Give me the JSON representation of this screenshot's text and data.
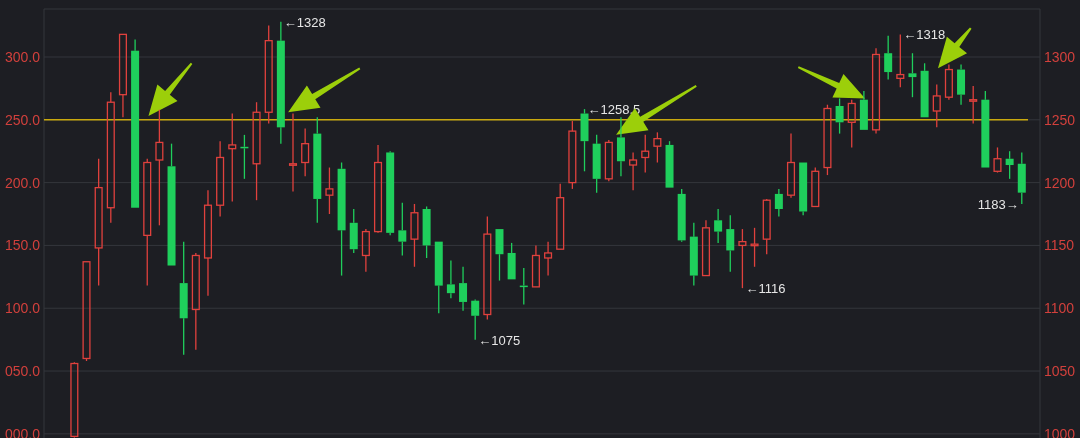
{
  "left_axis_labels": [
    "300.0",
    "250.0",
    "200.0",
    "150.0",
    "100.0",
    "050.0",
    "000.0"
  ],
  "chart_data": {
    "type": "candlestick",
    "ylim": [
      996.7,
      1338.2
    ],
    "yticks": [
      1300,
      1250,
      1200,
      1150,
      1100,
      1050,
      1000
    ],
    "grid": true,
    "categories": [
      null,
      null,
      null,
      null,
      null,
      null,
      null,
      null,
      null,
      null,
      null,
      null,
      null,
      null,
      null,
      null,
      null,
      null,
      null,
      null,
      null,
      null,
      null,
      null,
      null,
      null,
      null,
      null,
      null,
      null,
      null,
      null,
      null,
      null,
      null,
      null,
      null,
      null,
      null,
      null,
      null,
      null,
      null,
      null,
      null,
      null,
      null,
      null,
      null,
      null,
      null,
      null,
      null,
      null,
      null,
      null,
      null,
      null,
      null,
      null,
      null,
      null,
      null,
      null,
      null,
      null,
      null,
      null,
      null,
      null,
      null,
      null,
      null,
      null,
      null,
      null,
      null,
      null,
      null,
      null,
      null,
      null
    ],
    "ohlc": [
      null,
      null,
      [
        998,
        1057,
        997,
        1056
      ],
      [
        1060,
        1137,
        1058,
        1137
      ],
      [
        1148,
        1219,
        1118,
        1196
      ],
      [
        1180,
        1272,
        1168,
        1264
      ],
      [
        1270,
        1318,
        1252,
        1318
      ],
      [
        1305,
        1314,
        1180,
        1180
      ],
      [
        1158,
        1219,
        1118,
        1216
      ],
      [
        1218,
        1258,
        1166,
        1232
      ],
      [
        1213,
        1231,
        1134,
        1134
      ],
      [
        1120,
        1153,
        1063,
        1092
      ],
      [
        1099,
        1144,
        1067,
        1142
      ],
      [
        1140,
        1194,
        1110,
        1182
      ],
      [
        1182,
        1233,
        1173,
        1220
      ],
      [
        1227,
        1255,
        1185,
        1230
      ],
      [
        1228.5,
        1238,
        1203,
        1228
      ],
      [
        1215,
        1264,
        1186,
        1256
      ],
      [
        1256,
        1325,
        1247,
        1313
      ],
      [
        1313,
        1328,
        1231,
        1244
      ],
      [
        1214,
        1255,
        1193,
        1215
      ],
      [
        1216,
        1243,
        1205,
        1231
      ],
      [
        1239,
        1252,
        1168,
        1187
      ],
      [
        1190,
        1212,
        1175,
        1195
      ],
      [
        1211,
        1216,
        1126,
        1162
      ],
      [
        1168,
        1179,
        1144,
        1147
      ],
      [
        1142,
        1163,
        1129,
        1161
      ],
      [
        1161,
        1230,
        1160,
        1216
      ],
      [
        1224,
        1225,
        1158,
        1160
      ],
      [
        1162,
        1184,
        1142,
        1153
      ],
      [
        1155,
        1183,
        1133,
        1176
      ],
      [
        1179,
        1181,
        1140,
        1150
      ],
      [
        1153,
        1153,
        1096,
        1118
      ],
      [
        1119,
        1138,
        1108,
        1112
      ],
      [
        1120,
        1133,
        1098,
        1105
      ],
      [
        1106,
        1107,
        1075,
        1094
      ],
      [
        1095,
        1173,
        1091,
        1159
      ],
      [
        1163,
        1163,
        1122,
        1143
      ],
      [
        1144,
        1152,
        1123,
        1123
      ],
      [
        1118,
        1132,
        1103,
        1117.5
      ],
      [
        1117,
        1150,
        1117,
        1142
      ],
      [
        1140,
        1153,
        1126,
        1144
      ],
      [
        1147,
        1199,
        1147,
        1188
      ],
      [
        1200,
        1249,
        1195,
        1241
      ],
      [
        1255,
        1258.5,
        1209,
        1233
      ],
      [
        1231,
        1238,
        1192,
        1203
      ],
      [
        1203,
        1234,
        1201,
        1232
      ],
      [
        1236,
        1252,
        1205,
        1217
      ],
      [
        1214,
        1224,
        1194,
        1218
      ],
      [
        1220,
        1238,
        1208,
        1225
      ],
      [
        1229,
        1240,
        1216,
        1235
      ],
      [
        1230,
        1233,
        1196,
        1196
      ],
      [
        1191,
        1195,
        1153,
        1154
      ],
      [
        1157,
        1168,
        1118,
        1126
      ],
      [
        1126,
        1170,
        1126,
        1164
      ],
      [
        1170,
        1179,
        1152,
        1161
      ],
      [
        1163,
        1174,
        1129,
        1146
      ],
      [
        1150,
        1163,
        1116,
        1153
      ],
      [
        1150,
        1164,
        1133,
        1151
      ],
      [
        1155,
        1187,
        1143,
        1186
      ],
      [
        1191,
        1195,
        1173,
        1179
      ],
      [
        1190,
        1239,
        1188,
        1216
      ],
      [
        1216,
        1216,
        1174,
        1177
      ],
      [
        1181,
        1212,
        1181,
        1209
      ],
      [
        1212,
        1262,
        1206,
        1259
      ],
      [
        1261,
        1267,
        1239,
        1248
      ],
      [
        1248,
        1266,
        1228,
        1263
      ],
      [
        1266,
        1273,
        1242,
        1242
      ],
      [
        1242,
        1307,
        1239,
        1302
      ],
      [
        1303,
        1317,
        1282,
        1288
      ],
      [
        1283,
        1318,
        1276,
        1286
      ],
      [
        1287,
        1303,
        1268,
        1284
      ],
      [
        1289,
        1295,
        1252,
        1252
      ],
      [
        1257,
        1278,
        1244,
        1269
      ],
      [
        1268,
        1294,
        1266,
        1290
      ],
      [
        1290,
        1294,
        1262,
        1270
      ],
      [
        1265.5,
        1277,
        1247,
        1266
      ],
      [
        1266,
        1273,
        1212,
        1212
      ],
      [
        1209,
        1228,
        1208,
        1219
      ],
      [
        1219,
        1225,
        1203,
        1214
      ],
      [
        1215,
        1224,
        1183,
        1192
      ],
      null
    ],
    "ref_lines": [
      {
        "axis": "y",
        "value": 1250,
        "color": "#c9a90e"
      }
    ],
    "annotations": [
      "←1328",
      "←1258.5",
      "←1075",
      "←1116",
      "←1318",
      "1183→"
    ]
  }
}
